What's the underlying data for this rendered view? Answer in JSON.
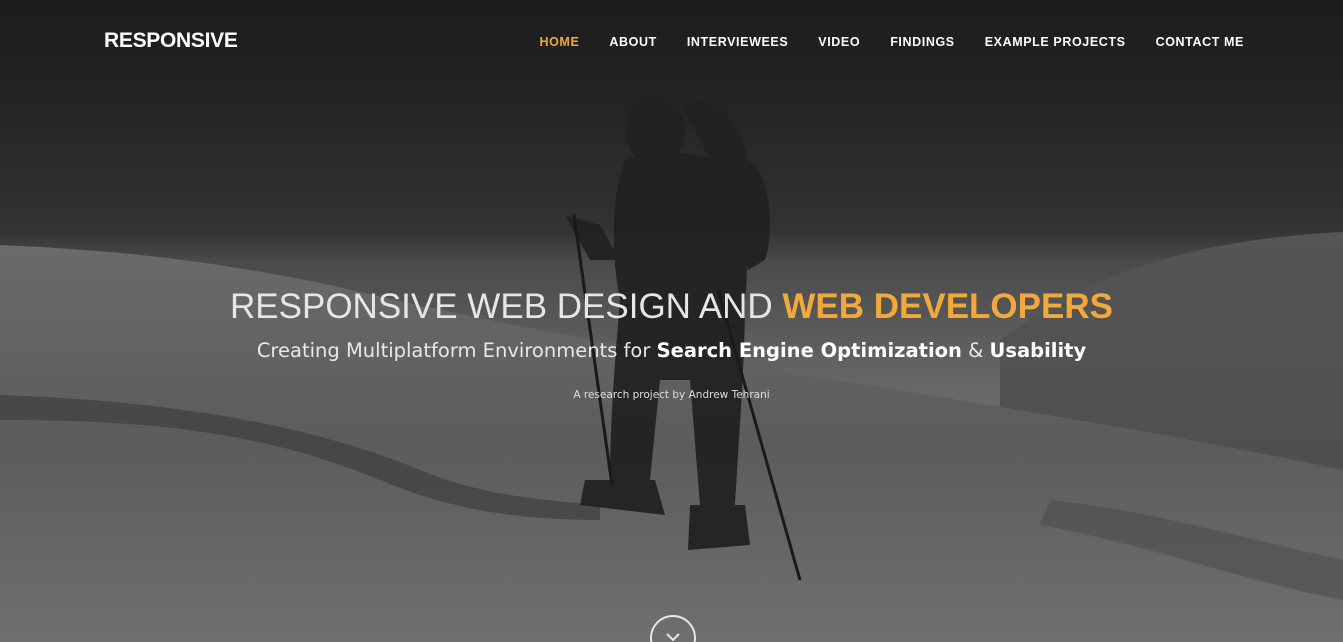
{
  "brand": "RESPONSIVE",
  "nav": {
    "items": [
      {
        "label": "HOME",
        "active": true
      },
      {
        "label": "ABOUT"
      },
      {
        "label": "INTERVIEWEES"
      },
      {
        "label": "VIDEO"
      },
      {
        "label": "FINDINGS"
      },
      {
        "label": "EXAMPLE PROJECTS"
      },
      {
        "label": "CONTACT ME"
      }
    ]
  },
  "hero": {
    "title_part1": "RESPONSIVE WEB DESIGN AND ",
    "title_accent": "WEB DEVELOPERS",
    "subtitle_part1": "Creating Multiplatform Environments for ",
    "subtitle_bold1": "Search Engine Optimization",
    "subtitle_amp": " & ",
    "subtitle_bold2": "Usability",
    "byline": "A research project by Andrew Tehrani"
  },
  "scroll_icon": "chevron-down-icon",
  "colors": {
    "accent": "#f2a93b",
    "text": "#ffffff"
  }
}
